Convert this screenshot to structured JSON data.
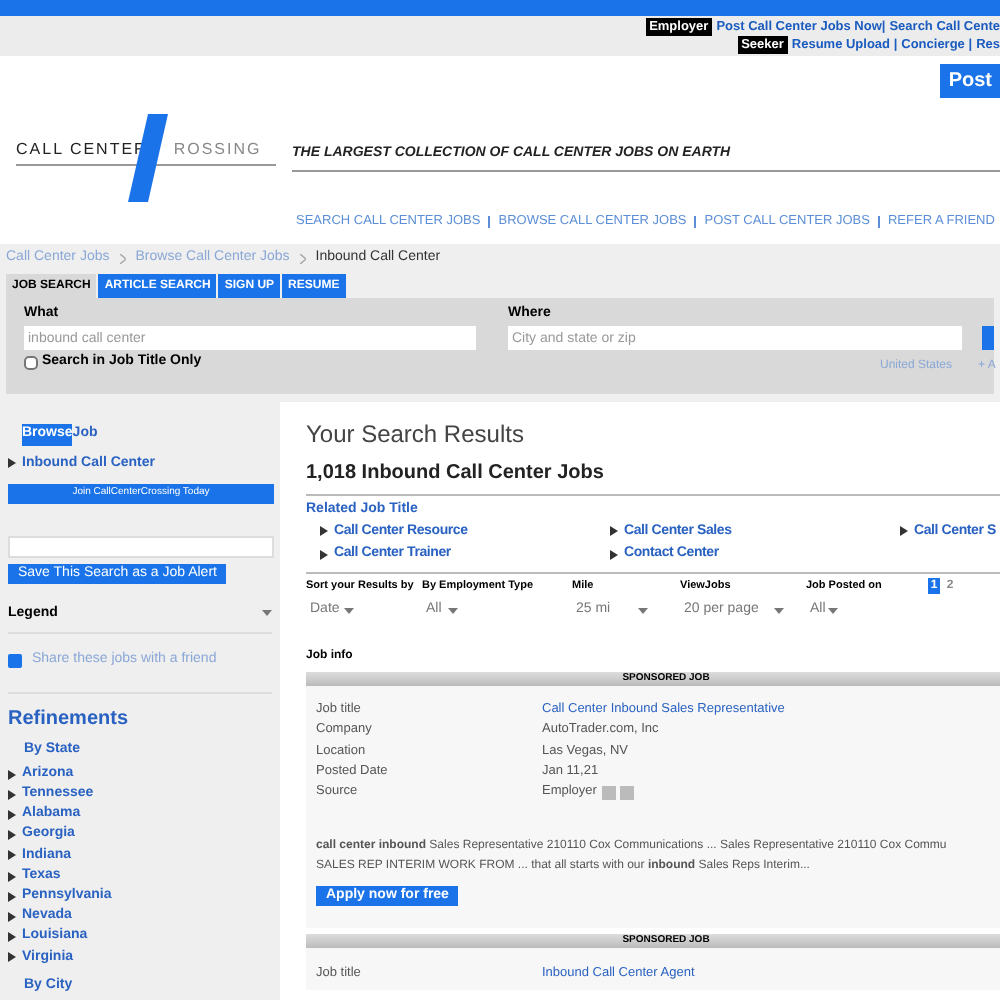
{
  "top_links": {
    "employer": {
      "badge": "Employer",
      "links": [
        "Post Call Center Jobs Now|",
        "Search Call Cente"
      ]
    },
    "seeker": {
      "badge": "Seeker",
      "links": [
        "Resume Upload |",
        "Concierge |",
        "Res"
      ]
    },
    "post_button": "Post"
  },
  "logo": {
    "left": "CALL CENTER",
    "right": "ROSSING"
  },
  "tagline": "THE LARGEST COLLECTION OF CALL CENTER JOBS ON EARTH",
  "nav": [
    "SEARCH CALL CENTER JOBS",
    "BROWSE CALL CENTER JOBS",
    "POST CALL CENTER JOBS",
    "REFER A FRIEND"
  ],
  "breadcrumb": [
    {
      "label": "Call Center Jobs",
      "link": true
    },
    {
      "label": "Browse Call Center Jobs",
      "link": true
    },
    {
      "label": "Inbound Call Center",
      "link": false
    }
  ],
  "tabs": [
    {
      "label": "JOB SEARCH",
      "selected": true
    },
    {
      "label": "ARTICLE SEARCH",
      "selected": false
    },
    {
      "label": "SIGN UP",
      "selected": false
    },
    {
      "label": "RESUME",
      "selected": false
    }
  ],
  "search": {
    "what_label": "What",
    "what_placeholder": "inbound call center",
    "title_only": {
      "label": "Search in Job Title Only",
      "checked": false
    },
    "where_label": "Where",
    "where_placeholder": "City and state or zip",
    "country": "United States",
    "add": "+ A"
  },
  "sidebar": {
    "browse": {
      "highlight": "Browse",
      "rest": "Job"
    },
    "browse_item": "Inbound Call Center",
    "join_button": "Join CallCenterCrossing Today",
    "alert_button": "Save This Search as a Job Alert",
    "legend": "Legend",
    "share": "Share these jobs with a friend",
    "refinements": "Refinements",
    "by_state": "By State",
    "states": [
      "Arizona",
      "Tennessee",
      "Alabama",
      "Georgia",
      "Indiana",
      "Texas",
      "Pennsylvania",
      "Nevada",
      "Louisiana",
      "Virginia"
    ],
    "by_city": "By City"
  },
  "results": {
    "title": "Your Search Results",
    "count": "1,018 Inbound Call Center Jobs",
    "related_label": "Related Job Title",
    "related": [
      "Call Center Resource",
      "Call Center Sales",
      "Call Center S",
      "Call Center Trainer",
      "Contact Center"
    ],
    "filters": [
      {
        "label": "Sort your Results by",
        "value": "Date"
      },
      {
        "label": "By Employment Type",
        "value": "All"
      },
      {
        "label": "Mile",
        "value": "25 mi"
      },
      {
        "label": "ViewJobs",
        "value": "20 per page"
      },
      {
        "label": "Job Posted on",
        "value": "All"
      }
    ],
    "pages": [
      {
        "label": "1",
        "selected": true
      },
      {
        "label": "2",
        "selected": false
      }
    ],
    "job_info": "Job info",
    "jobs": [
      {
        "banner": "SPONSORED JOB",
        "fields": [
          {
            "label": "Job title",
            "value": "Call Center Inbound Sales Representative"
          },
          {
            "label": "Company",
            "value": "AutoTrader.com, Inc"
          },
          {
            "label": "Location",
            "value": "Las Vegas, NV"
          },
          {
            "label": "Posted Date",
            "value": "Jan 11,21"
          },
          {
            "label": "Source",
            "value": "Employer"
          }
        ],
        "snippet": [
          "**call center inbound** Sales Representative 210110 Cox Communications ... Sales Representative 210110 Cox Commu",
          "SALES REP INTERIM WORK FROM ... that all starts with our **inbound** Sales Reps Interim..."
        ],
        "apply": "Apply now for free"
      },
      {
        "banner": "SPONSORED JOB",
        "fields": [
          {
            "label": "Job title",
            "value": "Inbound Call Center Agent"
          }
        ]
      }
    ]
  }
}
